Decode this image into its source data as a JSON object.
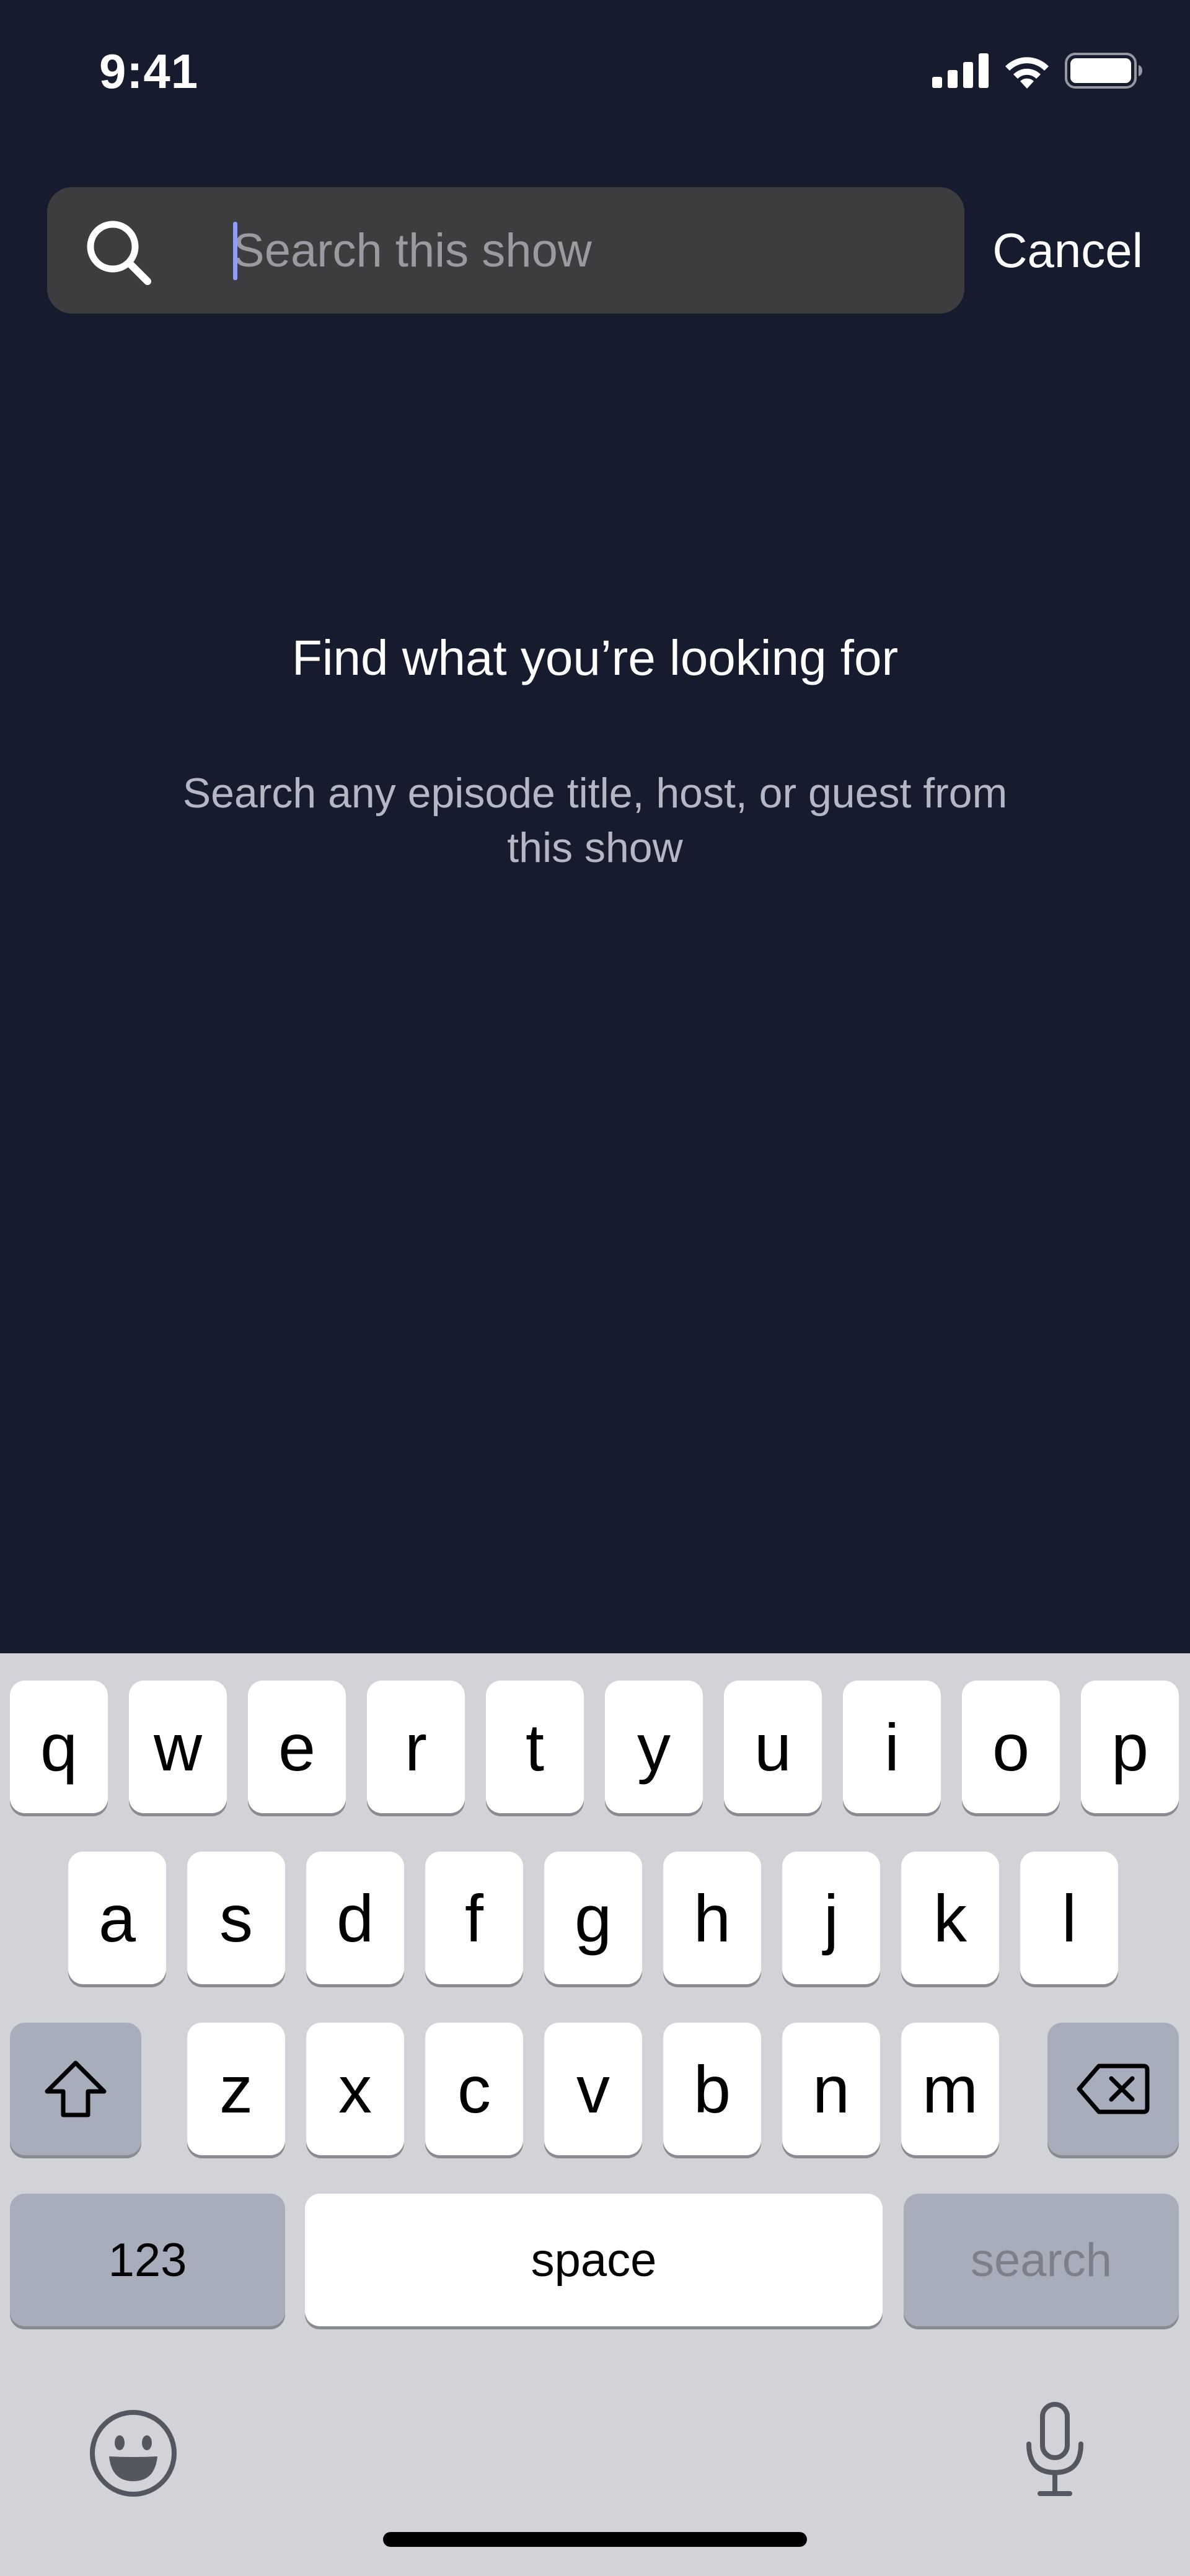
{
  "status_bar": {
    "time": "9:41",
    "icons": [
      "cellular-signal-icon",
      "wifi-icon",
      "battery-icon"
    ]
  },
  "search": {
    "placeholder": "Search this show",
    "value": "",
    "cancel_label": "Cancel"
  },
  "empty_state": {
    "title": "Find what you’re looking for",
    "subtitle": "Search any episode title, host, or guest from this show"
  },
  "keyboard": {
    "row1": [
      "q",
      "w",
      "e",
      "r",
      "t",
      "y",
      "u",
      "i",
      "o",
      "p"
    ],
    "row2": [
      "a",
      "s",
      "d",
      "f",
      "g",
      "h",
      "j",
      "k",
      "l"
    ],
    "row3": [
      "z",
      "x",
      "c",
      "v",
      "b",
      "n",
      "m"
    ],
    "numbers_label": "123",
    "space_label": "space",
    "search_label": "search",
    "icons": [
      "shift-icon",
      "backspace-icon",
      "emoji-icon",
      "microphone-icon"
    ]
  },
  "colors": {
    "background": "#161b2e",
    "search_field": "#3d3d40",
    "caret": "#8f9bff",
    "keyboard": "#d1d3d9",
    "key_dark": "#a8adbb"
  }
}
